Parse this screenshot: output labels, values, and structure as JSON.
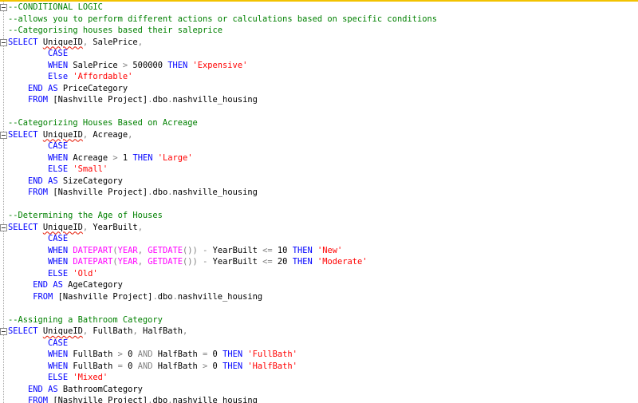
{
  "editor": {
    "colors": {
      "background": "#ffffff",
      "top_indicator": "#f2c200",
      "comment": "#008000",
      "keyword": "#0000ff",
      "string": "#ff0000",
      "function": "#ff00ff",
      "operator": "#808080",
      "identifier": "#000000",
      "squiggle": "#e51400"
    },
    "fold_icon": "collapse-minus-icon",
    "lines": [
      {
        "fold": true,
        "indent": "",
        "tokens": [
          {
            "t": "c",
            "v": "--CONDITIONAL LOGIC"
          }
        ]
      },
      {
        "indent": "",
        "tokens": [
          {
            "t": "c",
            "v": "--allows you to perform different actions or calculations based on specific conditions"
          }
        ]
      },
      {
        "indent": "",
        "tokens": [
          {
            "t": "c",
            "v": "--Categorising houses based their saleprice"
          }
        ]
      },
      {
        "fold": true,
        "indent": "",
        "tokens": [
          {
            "t": "k",
            "v": "SELECT"
          },
          {
            "t": "i",
            "v": " "
          },
          {
            "t": "i",
            "v": "UniqueID",
            "sq": true
          },
          {
            "t": "o",
            "v": ","
          },
          {
            "t": "i",
            "v": " SalePrice"
          },
          {
            "t": "o",
            "v": ","
          }
        ]
      },
      {
        "indent": "        ",
        "tokens": [
          {
            "t": "k",
            "v": "CASE"
          }
        ]
      },
      {
        "indent": "        ",
        "tokens": [
          {
            "t": "k",
            "v": "WHEN"
          },
          {
            "t": "i",
            "v": " SalePrice "
          },
          {
            "t": "o",
            "v": ">"
          },
          {
            "t": "i",
            "v": " 500000 "
          },
          {
            "t": "k",
            "v": "THEN"
          },
          {
            "t": "i",
            "v": " "
          },
          {
            "t": "s",
            "v": "'Expensive'"
          }
        ]
      },
      {
        "indent": "        ",
        "tokens": [
          {
            "t": "k",
            "v": "Else"
          },
          {
            "t": "i",
            "v": " "
          },
          {
            "t": "s",
            "v": "'Affordable'"
          }
        ]
      },
      {
        "indent": "    ",
        "tokens": [
          {
            "t": "k",
            "v": "END"
          },
          {
            "t": "i",
            "v": " "
          },
          {
            "t": "k",
            "v": "AS"
          },
          {
            "t": "i",
            "v": " PriceCategory"
          }
        ]
      },
      {
        "indent": "    ",
        "tokens": [
          {
            "t": "k",
            "v": "FROM"
          },
          {
            "t": "i",
            "v": " [Nashville Project]"
          },
          {
            "t": "o",
            "v": "."
          },
          {
            "t": "i",
            "v": "dbo"
          },
          {
            "t": "o",
            "v": "."
          },
          {
            "t": "i",
            "v": "nashville_housing"
          }
        ]
      },
      {
        "indent": "",
        "tokens": []
      },
      {
        "indent": "",
        "tokens": [
          {
            "t": "c",
            "v": "--Categorizing Houses Based on Acreage"
          }
        ]
      },
      {
        "fold": true,
        "indent": "",
        "tokens": [
          {
            "t": "k",
            "v": "SELECT"
          },
          {
            "t": "i",
            "v": " "
          },
          {
            "t": "i",
            "v": "UniqueID",
            "sq": true
          },
          {
            "t": "o",
            "v": ","
          },
          {
            "t": "i",
            "v": " Acreage"
          },
          {
            "t": "o",
            "v": ","
          }
        ]
      },
      {
        "indent": "        ",
        "tokens": [
          {
            "t": "k",
            "v": "CASE"
          }
        ]
      },
      {
        "indent": "        ",
        "tokens": [
          {
            "t": "k",
            "v": "WHEN"
          },
          {
            "t": "i",
            "v": " Acreage "
          },
          {
            "t": "o",
            "v": ">"
          },
          {
            "t": "i",
            "v": " 1 "
          },
          {
            "t": "k",
            "v": "THEN"
          },
          {
            "t": "i",
            "v": " "
          },
          {
            "t": "s",
            "v": "'Large'"
          }
        ]
      },
      {
        "indent": "        ",
        "tokens": [
          {
            "t": "k",
            "v": "ELSE"
          },
          {
            "t": "i",
            "v": " "
          },
          {
            "t": "s",
            "v": "'Small'"
          }
        ]
      },
      {
        "indent": "    ",
        "tokens": [
          {
            "t": "k",
            "v": "END"
          },
          {
            "t": "i",
            "v": " "
          },
          {
            "t": "k",
            "v": "AS"
          },
          {
            "t": "i",
            "v": " SizeCategory"
          }
        ]
      },
      {
        "indent": "    ",
        "tokens": [
          {
            "t": "k",
            "v": "FROM"
          },
          {
            "t": "i",
            "v": " [Nashville Project]"
          },
          {
            "t": "o",
            "v": "."
          },
          {
            "t": "i",
            "v": "dbo"
          },
          {
            "t": "o",
            "v": "."
          },
          {
            "t": "i",
            "v": "nashville_housing"
          }
        ]
      },
      {
        "indent": "",
        "tokens": []
      },
      {
        "indent": "",
        "tokens": [
          {
            "t": "c",
            "v": "--Determining the Age of Houses"
          }
        ]
      },
      {
        "fold": true,
        "indent": "",
        "tokens": [
          {
            "t": "k",
            "v": "SELECT"
          },
          {
            "t": "i",
            "v": " "
          },
          {
            "t": "i",
            "v": "UniqueID",
            "sq": true
          },
          {
            "t": "o",
            "v": ","
          },
          {
            "t": "i",
            "v": " YearBuilt"
          },
          {
            "t": "o",
            "v": ","
          }
        ]
      },
      {
        "indent": "        ",
        "tokens": [
          {
            "t": "k",
            "v": "CASE"
          }
        ]
      },
      {
        "indent": "        ",
        "tokens": [
          {
            "t": "k",
            "v": "WHEN"
          },
          {
            "t": "i",
            "v": " "
          },
          {
            "t": "f",
            "v": "DATEPART"
          },
          {
            "t": "o",
            "v": "("
          },
          {
            "t": "f",
            "v": "YEAR"
          },
          {
            "t": "o",
            "v": ","
          },
          {
            "t": "i",
            "v": " "
          },
          {
            "t": "f",
            "v": "GETDATE"
          },
          {
            "t": "o",
            "v": "())"
          },
          {
            "t": "i",
            "v": " "
          },
          {
            "t": "o",
            "v": "-"
          },
          {
            "t": "i",
            "v": " YearBuilt "
          },
          {
            "t": "o",
            "v": "<="
          },
          {
            "t": "i",
            "v": " 10 "
          },
          {
            "t": "k",
            "v": "THEN"
          },
          {
            "t": "i",
            "v": " "
          },
          {
            "t": "s",
            "v": "'New'"
          }
        ]
      },
      {
        "indent": "        ",
        "tokens": [
          {
            "t": "k",
            "v": "WHEN"
          },
          {
            "t": "i",
            "v": " "
          },
          {
            "t": "f",
            "v": "DATEPART"
          },
          {
            "t": "o",
            "v": "("
          },
          {
            "t": "f",
            "v": "YEAR"
          },
          {
            "t": "o",
            "v": ","
          },
          {
            "t": "i",
            "v": " "
          },
          {
            "t": "f",
            "v": "GETDATE"
          },
          {
            "t": "o",
            "v": "())"
          },
          {
            "t": "i",
            "v": " "
          },
          {
            "t": "o",
            "v": "-"
          },
          {
            "t": "i",
            "v": " YearBuilt "
          },
          {
            "t": "o",
            "v": "<="
          },
          {
            "t": "i",
            "v": " 20 "
          },
          {
            "t": "k",
            "v": "THEN"
          },
          {
            "t": "i",
            "v": " "
          },
          {
            "t": "s",
            "v": "'Moderate'"
          }
        ]
      },
      {
        "indent": "        ",
        "tokens": [
          {
            "t": "k",
            "v": "ELSE"
          },
          {
            "t": "i",
            "v": " "
          },
          {
            "t": "s",
            "v": "'Old'"
          }
        ]
      },
      {
        "indent": "     ",
        "tokens": [
          {
            "t": "k",
            "v": "END"
          },
          {
            "t": "i",
            "v": " "
          },
          {
            "t": "k",
            "v": "AS"
          },
          {
            "t": "i",
            "v": " AgeCategory"
          }
        ]
      },
      {
        "indent": "     ",
        "tokens": [
          {
            "t": "k",
            "v": "FROM"
          },
          {
            "t": "i",
            "v": " [Nashville Project]"
          },
          {
            "t": "o",
            "v": "."
          },
          {
            "t": "i",
            "v": "dbo"
          },
          {
            "t": "o",
            "v": "."
          },
          {
            "t": "i",
            "v": "nashville_housing"
          }
        ]
      },
      {
        "indent": "",
        "tokens": []
      },
      {
        "indent": "",
        "tokens": [
          {
            "t": "c",
            "v": "--Assigning a Bathroom Category"
          }
        ]
      },
      {
        "fold": true,
        "indent": "",
        "tokens": [
          {
            "t": "k",
            "v": "SELECT"
          },
          {
            "t": "i",
            "v": " "
          },
          {
            "t": "i",
            "v": "UniqueID",
            "sq": true
          },
          {
            "t": "o",
            "v": ","
          },
          {
            "t": "i",
            "v": " FullBath"
          },
          {
            "t": "o",
            "v": ","
          },
          {
            "t": "i",
            "v": " HalfBath"
          },
          {
            "t": "o",
            "v": ","
          }
        ]
      },
      {
        "indent": "        ",
        "tokens": [
          {
            "t": "k",
            "v": "CASE"
          }
        ]
      },
      {
        "indent": "        ",
        "tokens": [
          {
            "t": "k",
            "v": "WHEN"
          },
          {
            "t": "i",
            "v": " FullBath "
          },
          {
            "t": "o",
            "v": ">"
          },
          {
            "t": "i",
            "v": " 0 "
          },
          {
            "t": "o",
            "v": "AND"
          },
          {
            "t": "i",
            "v": " HalfBath "
          },
          {
            "t": "o",
            "v": "="
          },
          {
            "t": "i",
            "v": " 0 "
          },
          {
            "t": "k",
            "v": "THEN"
          },
          {
            "t": "i",
            "v": " "
          },
          {
            "t": "s",
            "v": "'FullBath'"
          }
        ]
      },
      {
        "indent": "        ",
        "tokens": [
          {
            "t": "k",
            "v": "WHEN"
          },
          {
            "t": "i",
            "v": " FullBath "
          },
          {
            "t": "o",
            "v": "="
          },
          {
            "t": "i",
            "v": " 0 "
          },
          {
            "t": "o",
            "v": "AND"
          },
          {
            "t": "i",
            "v": " HalfBath "
          },
          {
            "t": "o",
            "v": ">"
          },
          {
            "t": "i",
            "v": " 0 "
          },
          {
            "t": "k",
            "v": "THEN"
          },
          {
            "t": "i",
            "v": " "
          },
          {
            "t": "s",
            "v": "'HalfBath'"
          }
        ]
      },
      {
        "indent": "        ",
        "tokens": [
          {
            "t": "k",
            "v": "ELSE"
          },
          {
            "t": "i",
            "v": " "
          },
          {
            "t": "s",
            "v": "'Mixed'"
          }
        ]
      },
      {
        "indent": "    ",
        "tokens": [
          {
            "t": "k",
            "v": "END"
          },
          {
            "t": "i",
            "v": " "
          },
          {
            "t": "k",
            "v": "AS"
          },
          {
            "t": "i",
            "v": " BathroomCategory"
          }
        ]
      },
      {
        "indent": "    ",
        "tokens": [
          {
            "t": "k",
            "v": "FROM"
          },
          {
            "t": "i",
            "v": " [Nashville Project]"
          },
          {
            "t": "o",
            "v": "."
          },
          {
            "t": "i",
            "v": "dbo"
          },
          {
            "t": "o",
            "v": "."
          },
          {
            "t": "i",
            "v": "nashville_housing"
          }
        ]
      }
    ]
  }
}
